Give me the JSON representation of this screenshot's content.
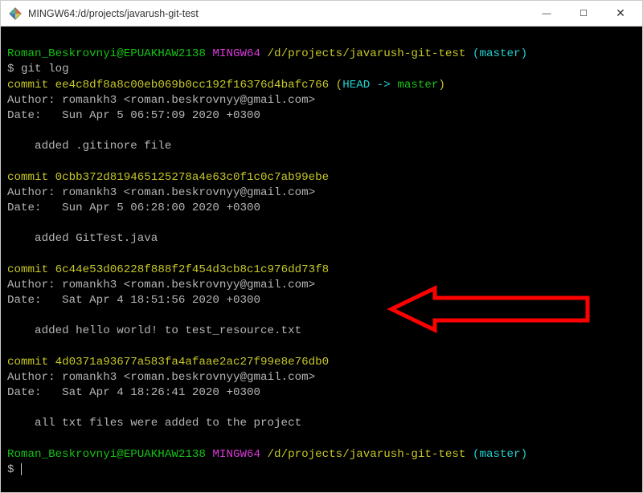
{
  "window": {
    "title": "MINGW64:/d/projects/javarush-git-test",
    "icon_name": "mingw-diamond-icon"
  },
  "win_controls": {
    "minimize": "—",
    "maximize": "☐",
    "close": "✕"
  },
  "prompt1": {
    "user_host": "Roman_Beskrovnyi@EPUAKHAW2138",
    "env": "MINGW64",
    "path": "/d/projects/javarush-git-test",
    "branch": "(master)",
    "symbol": "$ ",
    "command": "git log"
  },
  "commits": [
    {
      "prefix": "commit ",
      "hash": "ee4c8df8a8c00eb069b0cc192f16376d4bafc766",
      "ref_open": " (",
      "ref_head": "HEAD -> ",
      "ref_branch": "master",
      "ref_close": ")",
      "author": "Author: romankh3 <roman.beskrovnyy@gmail.com>",
      "date": "Date:   Sun Apr 5 06:57:09 2020 +0300",
      "msg": "    added .gitinore file"
    },
    {
      "prefix": "commit ",
      "hash": "0cbb372d819465125278a4e63c0f1c0c7ab99ebe",
      "author": "Author: romankh3 <roman.beskrovnyy@gmail.com>",
      "date": "Date:   Sun Apr 5 06:28:00 2020 +0300",
      "msg": "    added GitTest.java"
    },
    {
      "prefix": "commit ",
      "hash": "6c44e53d06228f888f2f454d3cb8c1c976dd73f8",
      "author": "Author: romankh3 <roman.beskrovnyy@gmail.com>",
      "date": "Date:   Sat Apr 4 18:51:56 2020 +0300",
      "msg": "    added hello world! to test_resource.txt"
    },
    {
      "prefix": "commit ",
      "hash": "4d0371a93677a583fa4afaae2ac27f99e8e76db0",
      "author": "Author: romankh3 <roman.beskrovnyy@gmail.com>",
      "date": "Date:   Sat Apr 4 18:26:41 2020 +0300",
      "msg": "    all txt files were added to the project"
    }
  ],
  "prompt2": {
    "user_host": "Roman_Beskrovnyi@EPUAKHAW2138",
    "env": "MINGW64",
    "path": "/d/projects/javarush-git-test",
    "branch": "(master)",
    "symbol": "$ "
  },
  "annotation": {
    "color": "#ff0000"
  }
}
